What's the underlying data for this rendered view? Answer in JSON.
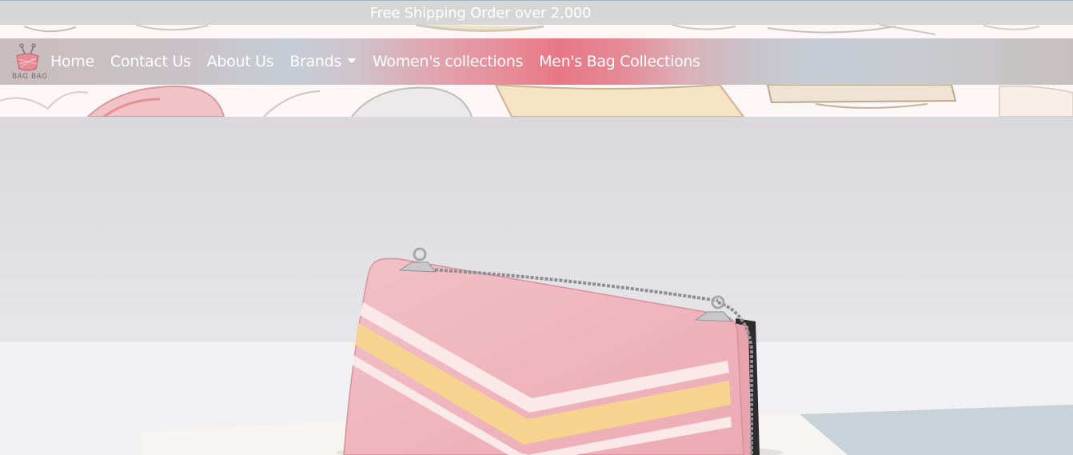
{
  "promo_bar": {
    "text": "Free Shipping Order over 2,000"
  },
  "brand": {
    "logo_text": "BAG BAG",
    "logo_icon": "handbag-logo-icon"
  },
  "nav": {
    "items": [
      {
        "label": "Home"
      },
      {
        "label": "Contact Us"
      },
      {
        "label": "About Us"
      },
      {
        "label": "Brands",
        "has_dropdown": true
      },
      {
        "label": "Women's collections"
      },
      {
        "label": "Men's Bag Collections"
      }
    ]
  },
  "hero": {
    "image": "pink-chain-shoulder-bag-photo"
  },
  "colors": {
    "accent_pink": "#e87785",
    "promo_bg": "#d6d6d6",
    "bag_pink": "#efb3bc",
    "stripe_yellow": "#f6d38f"
  }
}
